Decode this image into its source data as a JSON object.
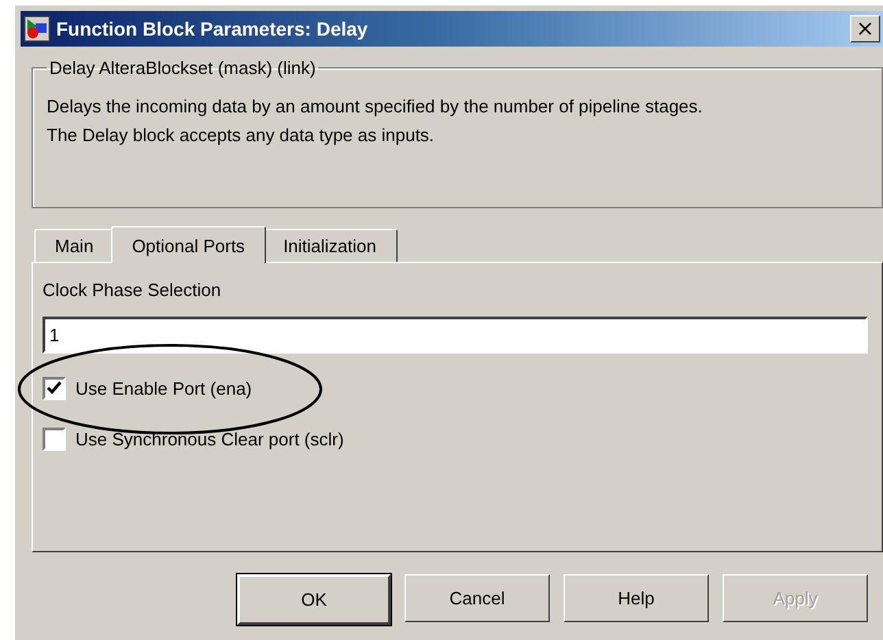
{
  "window": {
    "title": "Function Block Parameters: Delay",
    "close": "×"
  },
  "description": {
    "title": "Delay AlteraBlockset (mask) (link)",
    "text": "Delays the incoming data by an amount specified by the number of pipeline stages.\nThe Delay block accepts any data type as inputs."
  },
  "tabs": [
    {
      "label": "Main",
      "selected": false
    },
    {
      "label": "Optional Ports",
      "selected": true
    },
    {
      "label": "Initialization",
      "selected": false
    }
  ],
  "fields": [
    {
      "label": "Clock Phase Selection",
      "value": "1"
    }
  ],
  "checkboxes": [
    {
      "label": "Use Enable Port (ena)",
      "checked": true,
      "highlighted": true
    },
    {
      "label": "Use Synchronous Clear port (sclr)",
      "checked": false,
      "highlighted": false
    }
  ],
  "buttons": [
    {
      "label": "OK",
      "default": true,
      "disabled": false
    },
    {
      "label": "Cancel",
      "default": false,
      "disabled": false
    },
    {
      "label": "Help",
      "default": false,
      "disabled": false
    },
    {
      "label": "Apply",
      "default": false,
      "disabled": true
    }
  ]
}
